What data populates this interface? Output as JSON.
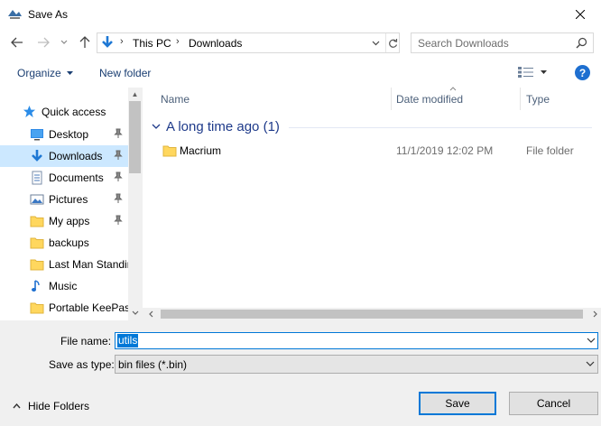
{
  "window": {
    "title": "Save As"
  },
  "nav": {
    "breadcrumbs": [
      "This PC",
      "Downloads"
    ],
    "search_placeholder": "Search Downloads"
  },
  "toolbar": {
    "organize": "Organize",
    "new_folder": "New folder"
  },
  "sidebar": {
    "quick_access": "Quick access",
    "items": [
      {
        "label": "Desktop",
        "icon": "desktop-icon",
        "pinned": true
      },
      {
        "label": "Downloads",
        "icon": "download-icon",
        "pinned": true,
        "selected": true
      },
      {
        "label": "Documents",
        "icon": "documents-icon",
        "pinned": true
      },
      {
        "label": "Pictures",
        "icon": "pictures-icon",
        "pinned": true
      },
      {
        "label": "My apps",
        "icon": "folder-icon",
        "pinned": true
      },
      {
        "label": "backups",
        "icon": "folder-icon",
        "pinned": false
      },
      {
        "label": "Last Man Standin",
        "icon": "folder-icon",
        "pinned": false
      },
      {
        "label": "Music",
        "icon": "music-icon",
        "pinned": false
      },
      {
        "label": "Portable KeePass",
        "icon": "folder-icon",
        "pinned": false
      }
    ]
  },
  "files": {
    "columns": {
      "name": "Name",
      "date": "Date modified",
      "type": "Type"
    },
    "group": "A long time ago (1)",
    "rows": [
      {
        "name": "Macrium",
        "date": "11/1/2019 12:02 PM",
        "type": "File folder"
      }
    ]
  },
  "form": {
    "file_name_label": "File name:",
    "file_name_value": "utils",
    "save_type_label": "Save as type:",
    "save_type_value": "bin files (*.bin)"
  },
  "footer": {
    "hide_folders": "Hide Folders",
    "save": "Save",
    "cancel": "Cancel"
  },
  "colors": {
    "accent": "#0078d7",
    "selection": "#cce8ff",
    "folder": "#ffd75e",
    "help": "#1e6fd0"
  }
}
